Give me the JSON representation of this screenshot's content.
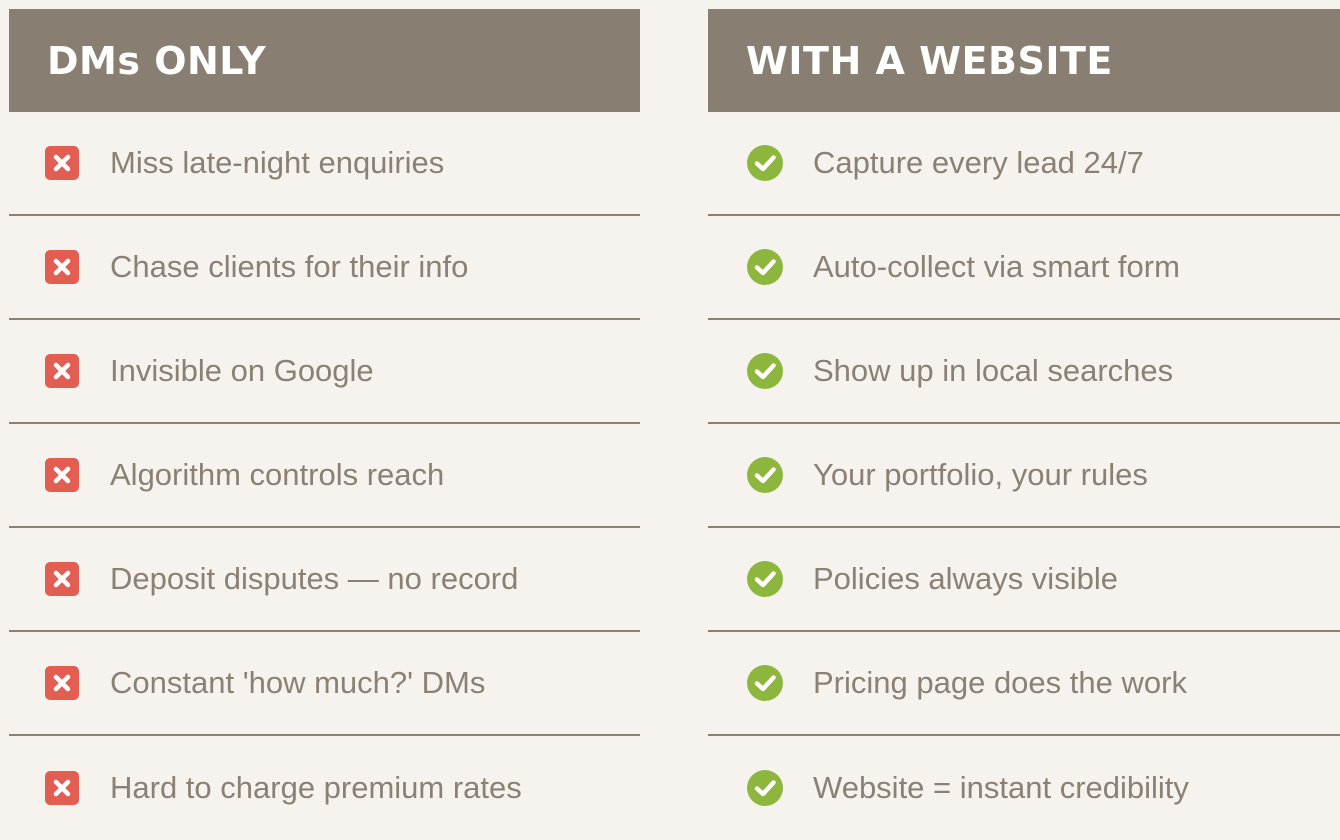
{
  "colors": {
    "header_bg": "#887e71",
    "header_text": "#ffffff",
    "row_text": "#8a8174",
    "divider": "#8a8174",
    "bad_icon": "#e25e52",
    "good_icon": "#8db63f",
    "page_bg": "#f6f3ef"
  },
  "left": {
    "heading": "DMs ONLY",
    "icon": "x-mark-icon",
    "items": [
      "Miss late-night enquiries",
      "Chase clients for their info",
      "Invisible on Google",
      "Algorithm controls reach",
      "Deposit disputes — no record",
      "Constant 'how much?' DMs",
      "Hard to charge premium rates"
    ]
  },
  "right": {
    "heading": "WITH A WEBSITE",
    "icon": "check-circle-icon",
    "items": [
      "Capture every lead 24/7",
      "Auto-collect via smart form",
      "Show up in local searches",
      "Your portfolio, your rules",
      "Policies always visible",
      "Pricing page does the work",
      "Website = instant credibility"
    ]
  }
}
